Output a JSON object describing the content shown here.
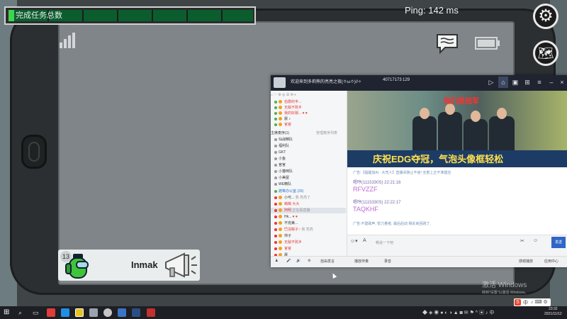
{
  "hud": {
    "task_bar_label": "完成任务总数",
    "ping": "Ping: 142 ms",
    "settings_icon": "gear-icon",
    "map_icon": "map-icon"
  },
  "tablet": {
    "icons": [
      "signal-icon",
      "chat-bubble-icon",
      "battery-icon"
    ]
  },
  "player": {
    "number": "13",
    "name": "Inmak",
    "color": "#3fc43a"
  },
  "app": {
    "title": "欢迎来到多莉熊的亮亮之夜(ㆁωㆁ)//✧",
    "viewer_id": "40717173",
    "online": "129",
    "left_top": [
      {
        "name": "伯爵的丰...",
        "red": true
      },
      {
        "name": "无敌不败乡",
        "red": true
      },
      {
        "name": "我的好朋...",
        "red": true
      },
      {
        "name": "晨 ♪",
        "red": false
      },
      {
        "name": "官官",
        "red": true
      }
    ],
    "section1": "主席麦序(1)",
    "section1_right": "管理麦序列表",
    "groups": [
      "仙战精队",
      "福利队",
      "GKT",
      "小鱼",
      "官官",
      "小猫咪队",
      "小美屋",
      "WE精队"
    ],
    "section2": "蹭等办公室 (26)",
    "left_bottom": [
      {
        "name": "小可...",
        "extra": "我 亮亮了"
      },
      {
        "name": "萌萌 大大"
      },
      {
        "name": "阿明",
        "extra": "正在看直播"
      },
      {
        "name": "Hk..."
      },
      {
        "name": "不完美..."
      },
      {
        "name": "巴浴粽子~",
        "extra": "我 亮亮"
      },
      {
        "name": "帅子"
      },
      {
        "name": "无敌不败乡"
      },
      {
        "name": "官官"
      },
      {
        "name": "晨"
      }
    ],
    "banner_headline": "我们是冠军",
    "banner_caption": "庆祝EDG夺冠，气泡头像框轻松",
    "messages": [
      {
        "type": "sys",
        "text": "广告:【提醒加AI · 大司人】直播间禁止不良! 全部上正不准建应"
      },
      {
        "type": "head",
        "text": "嗯哼(1115330S)  22:21:16"
      },
      {
        "type": "body",
        "text": "RFVZZF"
      },
      {
        "type": "head",
        "text": "嗯哼(1115330S)  22:22:17"
      },
      {
        "type": "body",
        "text": "TAQKHF"
      },
      {
        "type": "sys",
        "text": "广告:不建歌声, 暂力量者, 最后后动 相反来回跳了,"
      }
    ],
    "input_placeholder": "畅说一下吧",
    "send_label": "发送",
    "bottom": [
      "自由发言",
      "播放伴奏",
      "录音"
    ],
    "bottom_right": [
      "感谢播放",
      "应用中心"
    ]
  },
  "watermark": {
    "line1": "激活 Windows",
    "line2": "转到\"设置\"以激活 Windows。"
  },
  "taskbar": {
    "time": "23:32",
    "date": "2021/11/12",
    "lang": "中"
  }
}
